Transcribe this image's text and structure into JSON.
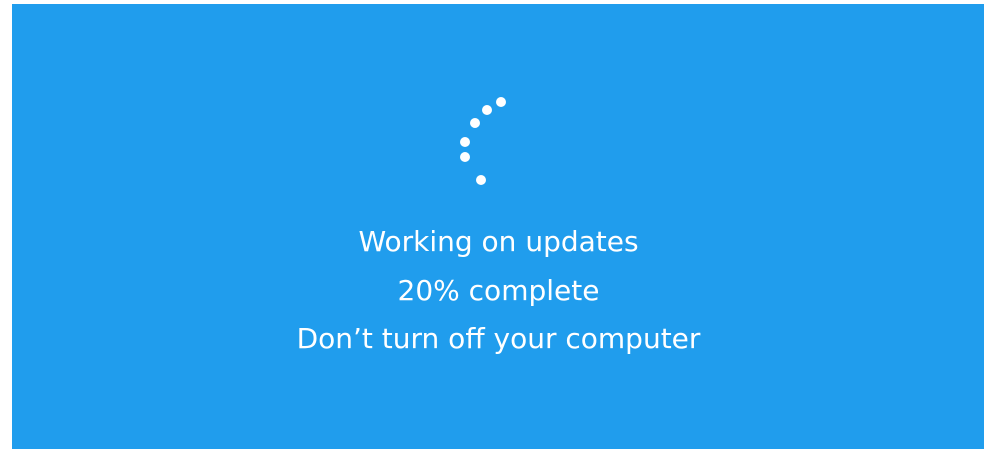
{
  "screen": {
    "background_color": "#209ded",
    "text_color": "#ffffff",
    "spinner_icon": "loading-spinner-icon",
    "status_title": "Working on updates",
    "progress_text": "20% complete",
    "progress_percent": 20,
    "warning_text": "Don’t turn off your computer"
  }
}
